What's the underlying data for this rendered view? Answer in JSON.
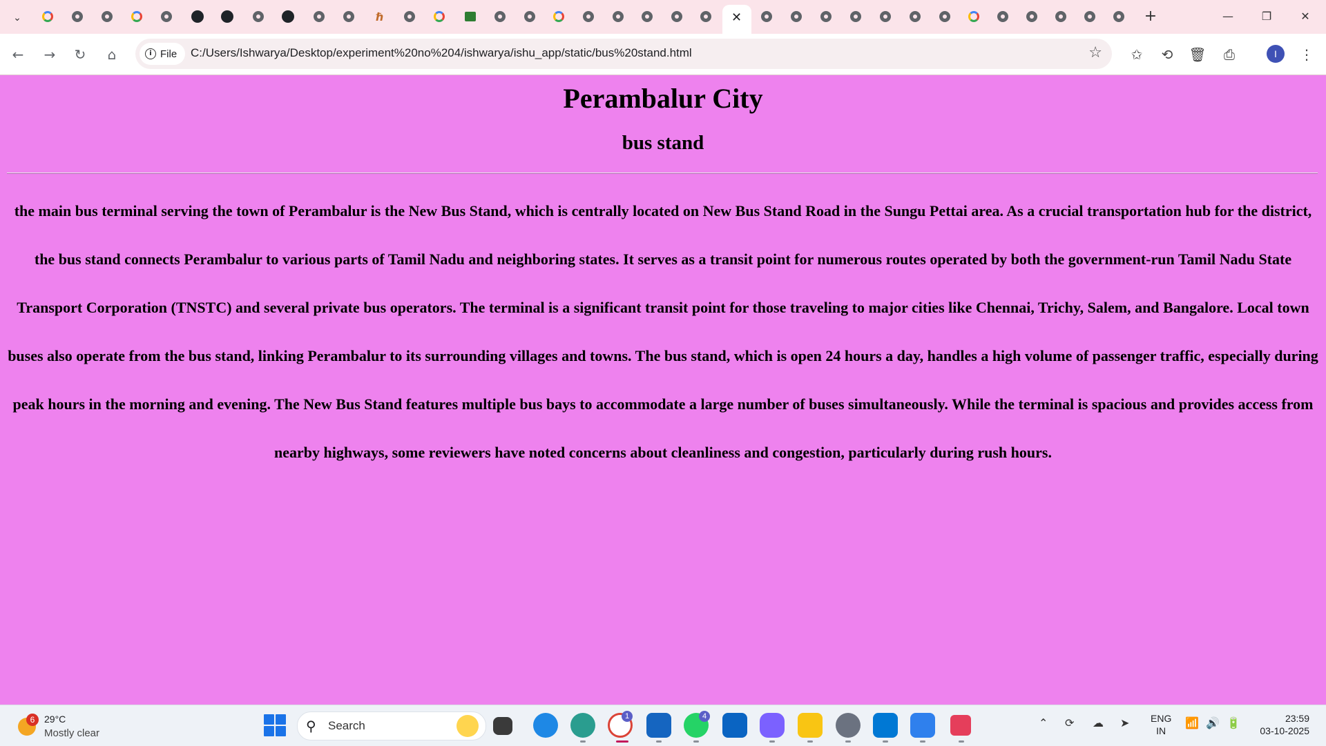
{
  "browser": {
    "active_tab_close": "✕",
    "new_tab": "+",
    "window_controls": {
      "minimize": "—",
      "restore": "❐",
      "close": "✕"
    },
    "toolbar": {
      "back": "←",
      "forward": "→",
      "reload": "↻",
      "home": "⌂"
    },
    "address": {
      "chip_label": "File",
      "url": "C:/Users/Ishwarya/Desktop/experiment%20no%204/ishwarya/ishu_app/static/bus%20stand.html"
    },
    "profile_initial": "I"
  },
  "page": {
    "title": "Perambalur City",
    "subtitle": "bus stand",
    "body": "the main bus terminal serving the town of Perambalur is the New Bus Stand, which is centrally located on New Bus Stand Road in the Sungu Pettai area. As a crucial transportation hub for the district, the bus stand connects Perambalur to various parts of Tamil Nadu and neighboring states. It serves as a transit point for numerous routes operated by both the government-run Tamil Nadu State Transport Corporation (TNSTC) and several private bus operators. The terminal is a significant transit point for those traveling to major cities like Chennai, Trichy, Salem, and Bangalore. Local town buses also operate from the bus stand, linking Perambalur to its surrounding villages and towns. The bus stand, which is open 24 hours a day, handles a high volume of passenger traffic, especially during peak hours in the morning and evening. The New Bus Stand features multiple bus bays to accommodate a large number of buses simultaneously. While the terminal is spacious and provides access from nearby highways, some reviewers have noted concerns about cleanliness and congestion, particularly during rush hours.",
    "background_color": "#ee82ee"
  },
  "taskbar": {
    "weather": {
      "temp": "29°C",
      "condition": "Mostly clear",
      "badge": "6"
    },
    "search_label": "Search",
    "badges": {
      "chrome": "1",
      "whatsapp": "4"
    },
    "language": {
      "line1": "ENG",
      "line2": "IN"
    },
    "clock": {
      "time": "23:59",
      "date": "03-10-2025"
    }
  }
}
